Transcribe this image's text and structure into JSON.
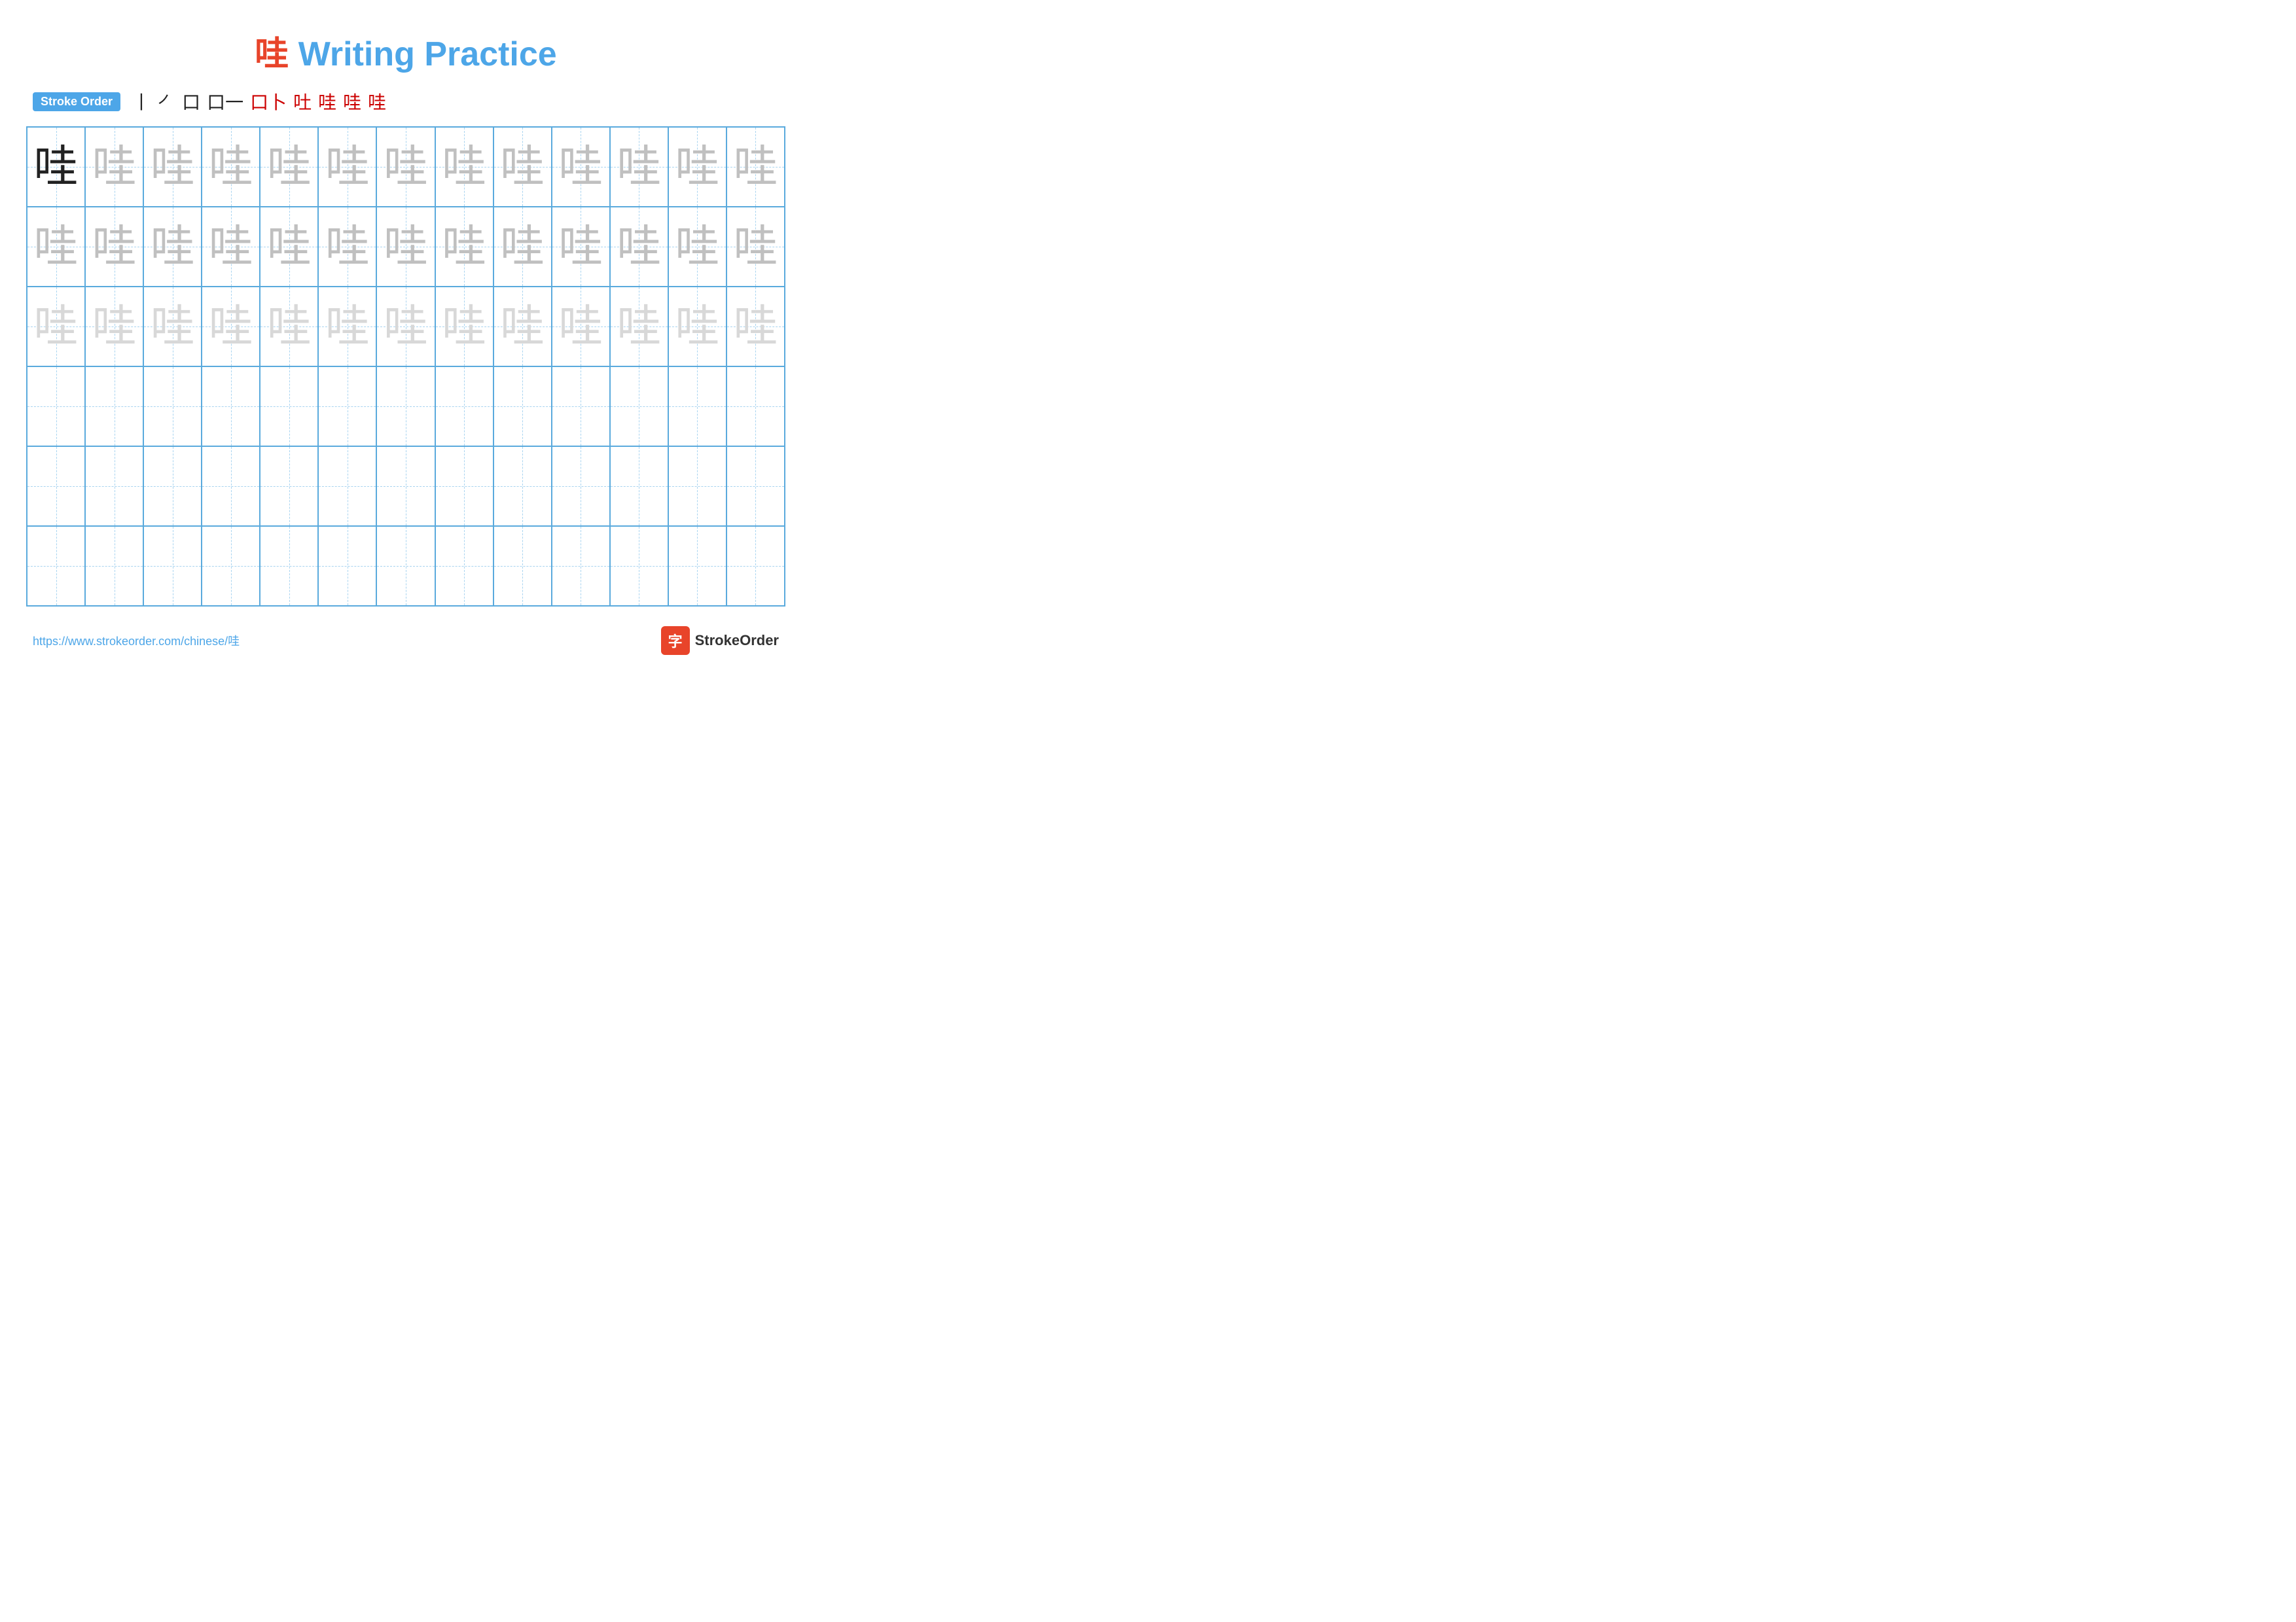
{
  "title": "哇 Writing Practice",
  "title_char": "哇",
  "title_rest": " Writing Practice",
  "stroke_order_label": "Stroke Order",
  "stroke_steps": [
    "丨",
    "𠂉",
    "口",
    "口一",
    "口卜",
    "吐",
    "哇",
    "哇",
    "哇"
  ],
  "stroke_red_from": 5,
  "char": "哇",
  "rows": [
    {
      "type": "solid_then_light1",
      "count": 13
    },
    {
      "type": "light1",
      "count": 13
    },
    {
      "type": "light2",
      "count": 13
    },
    {
      "type": "empty",
      "count": 13
    },
    {
      "type": "empty",
      "count": 13
    },
    {
      "type": "empty",
      "count": 13
    }
  ],
  "footer": {
    "url": "https://www.strokeorder.com/chinese/哇",
    "brand": "StrokeOrder"
  }
}
